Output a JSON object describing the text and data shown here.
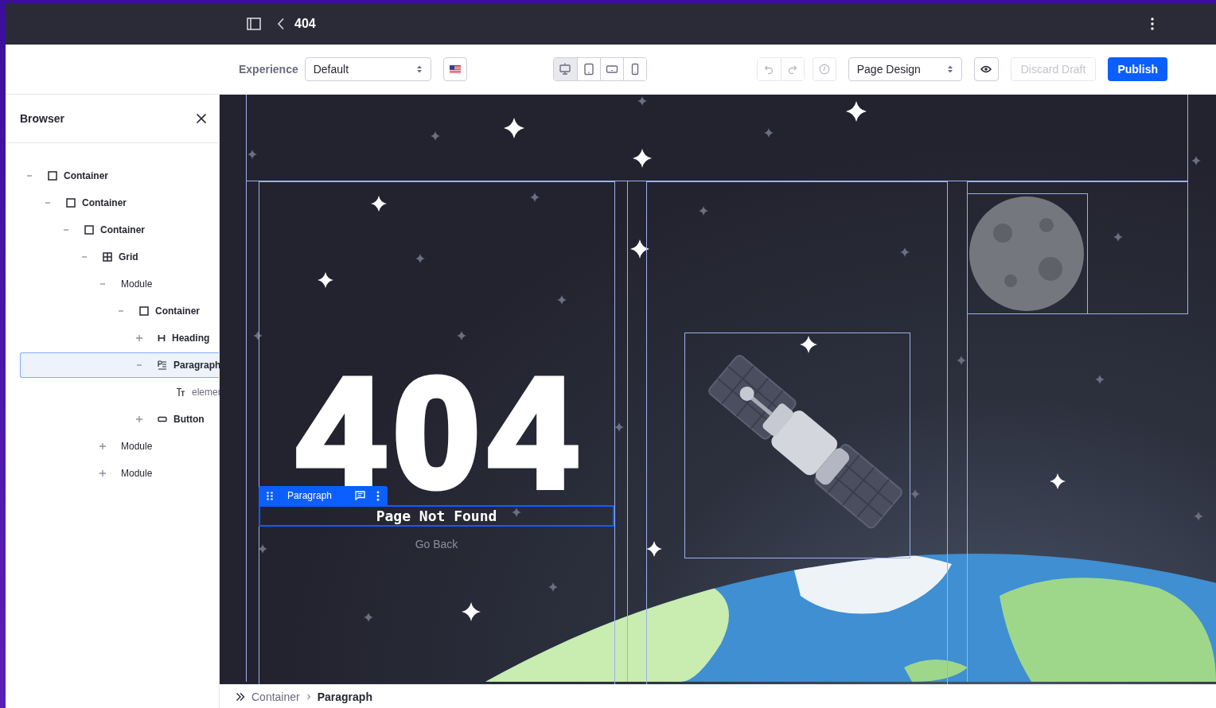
{
  "top_bar": {
    "title": "404"
  },
  "toolbar": {
    "experience_label": "Experience",
    "experience": "Default",
    "viewports": [
      {
        "kind": "desktop",
        "selected": true
      },
      {
        "kind": "tablet",
        "selected": false
      },
      {
        "kind": "landscape",
        "selected": false
      },
      {
        "kind": "mobile",
        "selected": false
      }
    ],
    "undo": {
      "disabled": true
    },
    "redo": {
      "disabled": true
    },
    "mode": "Page Design",
    "discard": {
      "label": "Discard Draft",
      "disabled": true
    },
    "publish": "Publish"
  },
  "browser": {
    "title": "Browser",
    "tree": [
      {
        "kind": "container",
        "label": "Container",
        "expanded": true,
        "selected": false,
        "children": [
          {
            "kind": "container",
            "label": "Container",
            "expanded": true,
            "selected": false,
            "children": [
              {
                "kind": "container",
                "label": "Container",
                "expanded": true,
                "selected": false,
                "children": [
                  {
                    "kind": "grid",
                    "label": "Grid",
                    "expanded": true,
                    "selected": false,
                    "children": [
                      {
                        "kind": "module",
                        "label": "Module",
                        "expanded": true,
                        "selected": false,
                        "children": [
                          {
                            "kind": "container",
                            "label": "Container",
                            "expanded": true,
                            "selected": false,
                            "children": [
                              {
                                "kind": "heading",
                                "label": "Heading",
                                "expanded": false,
                                "selected": false
                              },
                              {
                                "kind": "paragraph",
                                "label": "Paragraph",
                                "expanded": true,
                                "selected": true,
                                "children": [
                                  {
                                    "kind": "text",
                                    "label": "elemer",
                                    "selected": false
                                  }
                                ]
                              },
                              {
                                "kind": "button",
                                "label": "Button",
                                "expanded": false,
                                "selected": false
                              }
                            ]
                          }
                        ]
                      },
                      {
                        "kind": "module",
                        "label": "Module",
                        "expanded": false,
                        "selected": false
                      },
                      {
                        "kind": "module",
                        "label": "Module",
                        "expanded": false,
                        "selected": false
                      }
                    ]
                  }
                ]
              }
            ]
          }
        ]
      }
    ]
  },
  "canvas": {
    "heading": "404",
    "toolbar_label": "Paragraph",
    "paragraph": "Page Not Found",
    "button": "Go Back"
  },
  "breadcrumb": [
    {
      "label": "Container",
      "current": false
    },
    {
      "label": "Paragraph",
      "current": true
    }
  ]
}
